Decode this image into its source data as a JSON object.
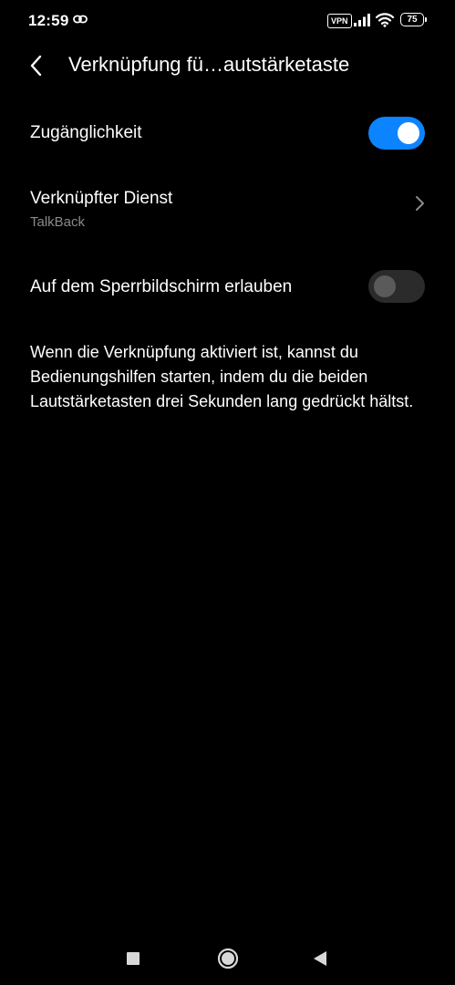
{
  "status_bar": {
    "time": "12:59",
    "vpn": "VPN",
    "battery": "75"
  },
  "header": {
    "title": "Verknüpfung fü…autstärketaste"
  },
  "settings": {
    "accessibility": {
      "title": "Zugänglichkeit",
      "enabled": true
    },
    "linked_service": {
      "title": "Verknüpfter Dienst",
      "value": "TalkBack"
    },
    "lock_screen": {
      "title": "Auf dem Sperrbildschirm erlauben",
      "enabled": false
    }
  },
  "description": "Wenn die Verknüpfung aktiviert ist, kannst du Bedienungshilfen starten, indem du die beiden Lautstärketasten drei Sekunden lang gedrückt hältst.",
  "colors": {
    "background": "#000000",
    "accent": "#0d84ff",
    "secondary_text": "#8a8a8a"
  },
  "icons": {
    "back": "back-arrow-icon",
    "chevron": "chevron-right-icon",
    "link": "link-icon",
    "signal": "signal-icon",
    "wifi": "wifi-icon",
    "nav_recents": "square-icon",
    "nav_home": "circle-icon",
    "nav_back": "triangle-icon"
  }
}
